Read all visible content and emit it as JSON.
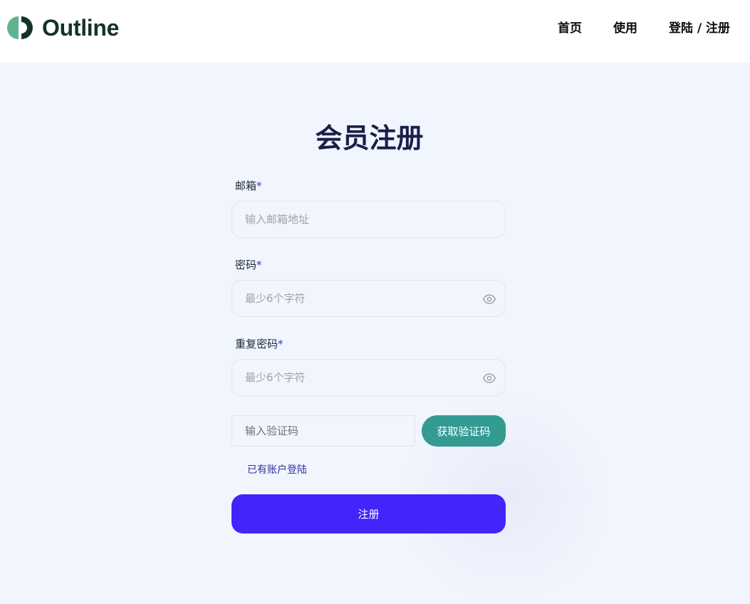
{
  "header": {
    "logo_text": "Outline",
    "nav": {
      "home": "首页",
      "use": "使用",
      "login_register": "登陆 / 注册"
    }
  },
  "form": {
    "title": "会员注册",
    "email": {
      "label": "邮箱",
      "required_mark": "*",
      "placeholder": "输入邮箱地址"
    },
    "password": {
      "label": "密码",
      "required_mark": "*",
      "placeholder": "最少6个字符"
    },
    "repeat_password": {
      "label": "重复密码",
      "required_mark": "*",
      "placeholder": "最少6个字符"
    },
    "code": {
      "placeholder": "输入验证码",
      "button": "获取验证码"
    },
    "login_link": "已有账户登陆",
    "submit": "注册"
  },
  "colors": {
    "brand_green": "#143328",
    "logo_accent": "#5fb38e",
    "code_button": "#339b92",
    "submit_button": "#4125fb",
    "link": "#3730a3"
  },
  "icons": {
    "logo": "outline-logo-icon",
    "password_toggle": "eye-icon"
  }
}
